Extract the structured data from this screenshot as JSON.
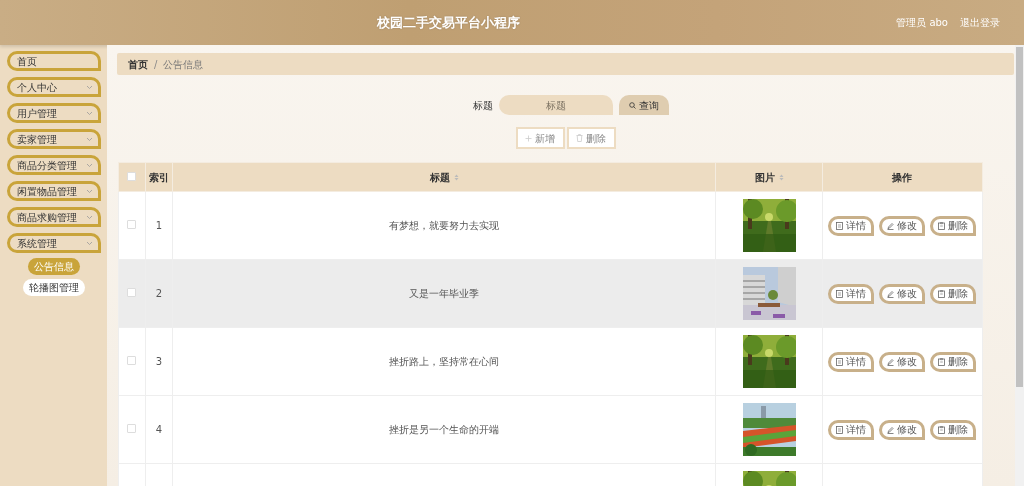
{
  "header": {
    "title": "校园二手交易平台小程序",
    "user": "管理员 abo",
    "logout": "退出登录"
  },
  "sidebar": {
    "items": [
      {
        "label": "首页",
        "expandable": false
      },
      {
        "label": "个人中心",
        "expandable": true
      },
      {
        "label": "用户管理",
        "expandable": true
      },
      {
        "label": "卖家管理",
        "expandable": true
      },
      {
        "label": "商品分类管理",
        "expandable": true
      },
      {
        "label": "闲置物品管理",
        "expandable": true
      },
      {
        "label": "商品求购管理",
        "expandable": true
      },
      {
        "label": "系统管理",
        "expandable": true,
        "children": [
          {
            "label": "公告信息",
            "selected": true
          },
          {
            "label": "轮播图管理",
            "selected": false
          }
        ]
      }
    ]
  },
  "breadcrumb": [
    "首页",
    "公告信息"
  ],
  "breadcrumb_separator": "/",
  "search": {
    "label": "标题",
    "placeholder": "标题",
    "button": "查询"
  },
  "actions": [
    "新增",
    "删除"
  ],
  "table": {
    "select_all": {
      "checked": false
    },
    "columns": [
      {
        "label": "索引",
        "sortable": false
      },
      {
        "label": "标题",
        "sortable": true
      },
      {
        "label": "图片",
        "sortable": true
      },
      {
        "label": "操作",
        "sortable": false
      }
    ],
    "rows": [
      {
        "checked": false,
        "highlighted": false,
        "index": "1",
        "title": "有梦想，就要努力去实现",
        "image": {
          "kind": "picture"
        },
        "buttons": [
          "详情",
          "修改",
          "删除"
        ]
      },
      {
        "checked": false,
        "highlighted": true,
        "index": "2",
        "title": "又是一年毕业季",
        "image": {
          "kind": "picture"
        },
        "buttons": [
          "详情",
          "修改",
          "删除"
        ]
      },
      {
        "checked": false,
        "highlighted": false,
        "index": "3",
        "title": "挫折路上，坚持常在心间",
        "image": {
          "kind": "picture"
        },
        "buttons": [
          "详情",
          "修改",
          "删除"
        ]
      },
      {
        "checked": false,
        "highlighted": false,
        "index": "4",
        "title": "挫折是另一个生命的开端",
        "image": {
          "kind": "picture"
        },
        "buttons": [
          "详情",
          "修改",
          "删除"
        ]
      },
      {
        "image": {
          "kind": "picture"
        }
      }
    ]
  }
}
